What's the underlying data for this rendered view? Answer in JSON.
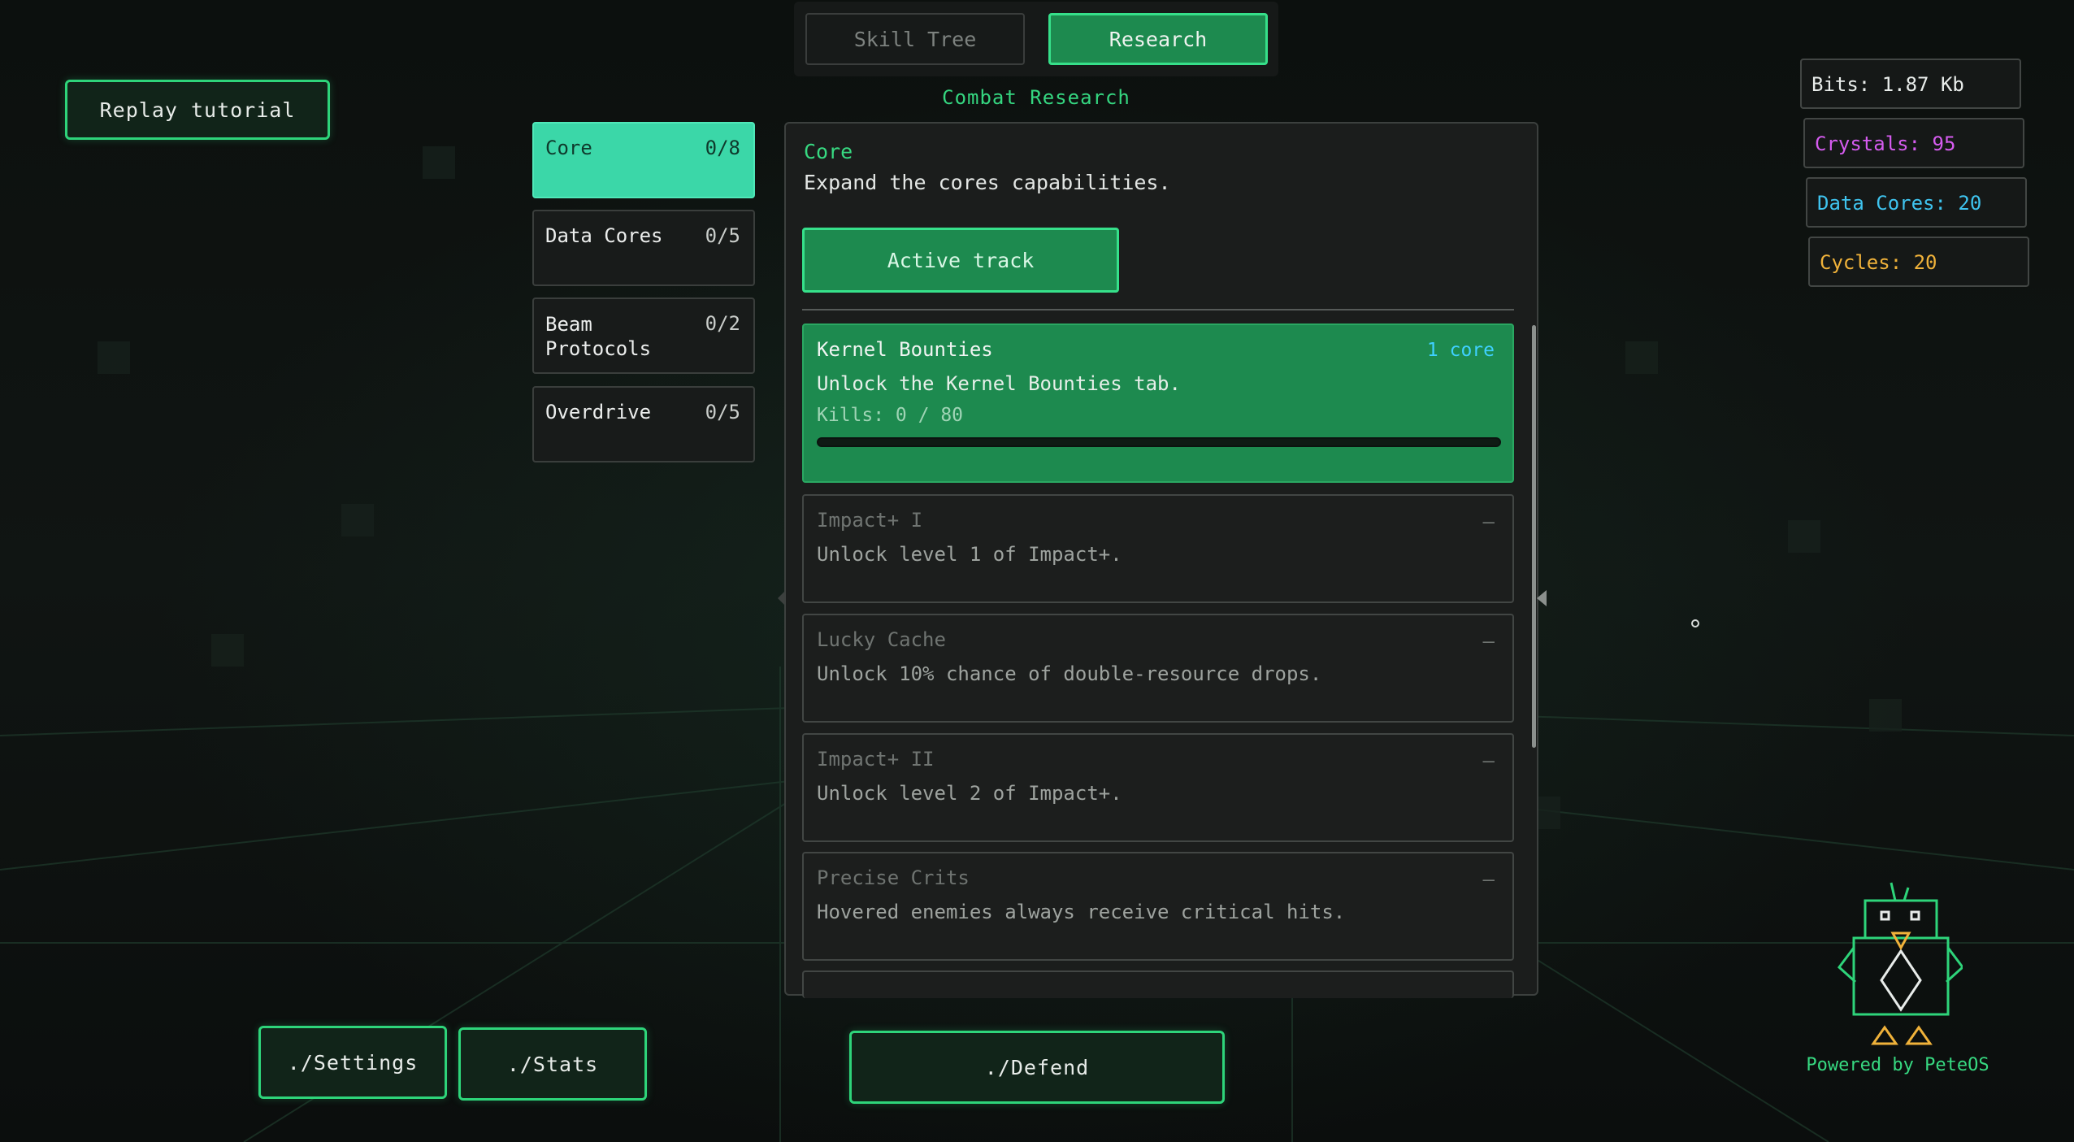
{
  "header": {
    "tabs": [
      {
        "label": "Skill Tree",
        "active": false
      },
      {
        "label": "Research",
        "active": true
      }
    ],
    "section_title": "Combat Research"
  },
  "replay_tutorial_label": "Replay tutorial",
  "categories": [
    {
      "label": "Core",
      "count": "0/8",
      "active": true
    },
    {
      "label": "Data Cores",
      "count": "0/5",
      "active": false
    },
    {
      "label": "Beam Protocols",
      "count": "0/2",
      "active": false
    },
    {
      "label": "Overdrive",
      "count": "0/5",
      "active": false
    }
  ],
  "panel": {
    "title": "Core",
    "description": "Expand the cores capabilities.",
    "active_track_label": "Active track",
    "items": [
      {
        "name": "Kernel Bounties",
        "cost": "1 core",
        "description": "Unlock the Kernel Bounties tab.",
        "progress_label": "Kills: 0 / 80",
        "progress": 0,
        "current": true
      },
      {
        "name": "Impact+ I",
        "marker": "—",
        "description": "Unlock level 1 of Impact+."
      },
      {
        "name": "Lucky Cache",
        "marker": "—",
        "description": "Unlock 10% chance of double-resource drops."
      },
      {
        "name": "Impact+ II",
        "marker": "—",
        "description": "Unlock level 2 of Impact+."
      },
      {
        "name": "Precise Crits",
        "marker": "—",
        "description": "Hovered enemies always receive critical hits."
      }
    ]
  },
  "resources": [
    {
      "label": "Bits: 1.87 Kb",
      "color": "#e8ecea"
    },
    {
      "label": "Crystals: 95",
      "color": "#d65cf0"
    },
    {
      "label": "Data Cores: 20",
      "color": "#3fc4ef"
    },
    {
      "label": "Cycles: 20",
      "color": "#f0b23a"
    }
  ],
  "bottom": {
    "settings_label": "./Settings",
    "stats_label": "./Stats",
    "defend_label": "./Defend"
  },
  "footer": {
    "powered_by": "Powered by PeteOS"
  },
  "colors": {
    "accent": "#36e08a",
    "active_fill": "#1d8a4f",
    "category_active": "#3bd7a8"
  }
}
